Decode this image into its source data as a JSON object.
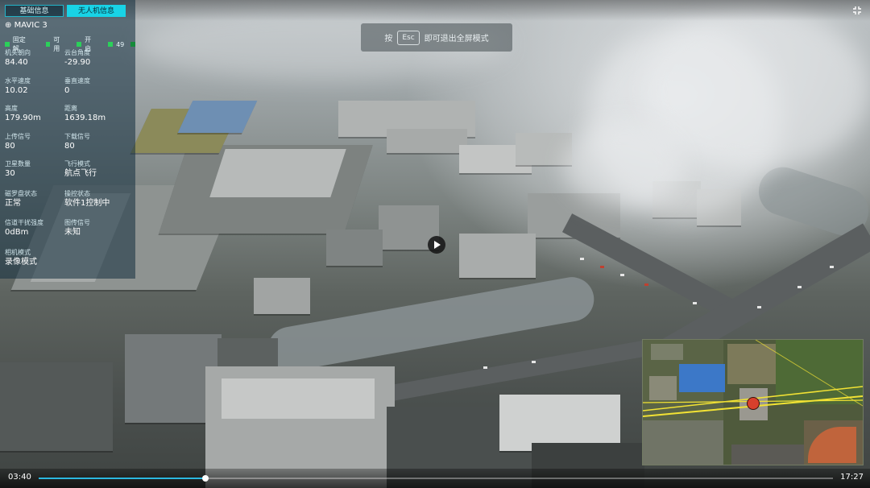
{
  "tabs": [
    {
      "label": "基础信息",
      "active": false
    },
    {
      "label": "无人机信息",
      "active": true
    }
  ],
  "drone": {
    "name": "MAVIC 3",
    "status": [
      {
        "label": "固定解",
        "indicator": "green"
      },
      {
        "label": "可用",
        "indicator": "green"
      },
      {
        "label": "开启",
        "indicator": "green"
      },
      {
        "label": "49",
        "indicator": "green"
      }
    ],
    "fields": [
      {
        "label": "机头朝向",
        "value": "84.40"
      },
      {
        "label": "云台角度",
        "value": "-29.90"
      },
      {
        "label": "水平速度",
        "value": "10.02"
      },
      {
        "label": "垂直速度",
        "value": "0"
      },
      {
        "label": "高度",
        "value": "179.90m"
      },
      {
        "label": "距离",
        "value": "1639.18m"
      },
      {
        "label": "上传信号",
        "value": "80"
      },
      {
        "label": "下载信号",
        "value": "80"
      },
      {
        "label": "卫星数量",
        "value": "30"
      },
      {
        "label": "飞行模式",
        "value": "航点飞行"
      },
      {
        "label": "磁罗盘状态",
        "value": "正常"
      },
      {
        "label": "操控状态",
        "value": "软件1控制中"
      },
      {
        "label": "信道干扰强度",
        "value": "0dBm"
      },
      {
        "label": "图传信号",
        "value": "未知"
      },
      {
        "label": "相机模式",
        "value": "录像模式"
      }
    ]
  },
  "esc_hint": {
    "prefix": "按",
    "key": "Esc",
    "suffix": "即可退出全屏模式"
  },
  "player": {
    "current_time": "03:40",
    "total_time": "17:27",
    "progress": 0.21
  },
  "icons": {
    "fullscreen": "fullscreen-exit-icon",
    "play": "play-icon"
  },
  "colors": {
    "accent": "#18d3e6",
    "status_green": "#2bd05a",
    "progress": "#2bb8e0"
  }
}
